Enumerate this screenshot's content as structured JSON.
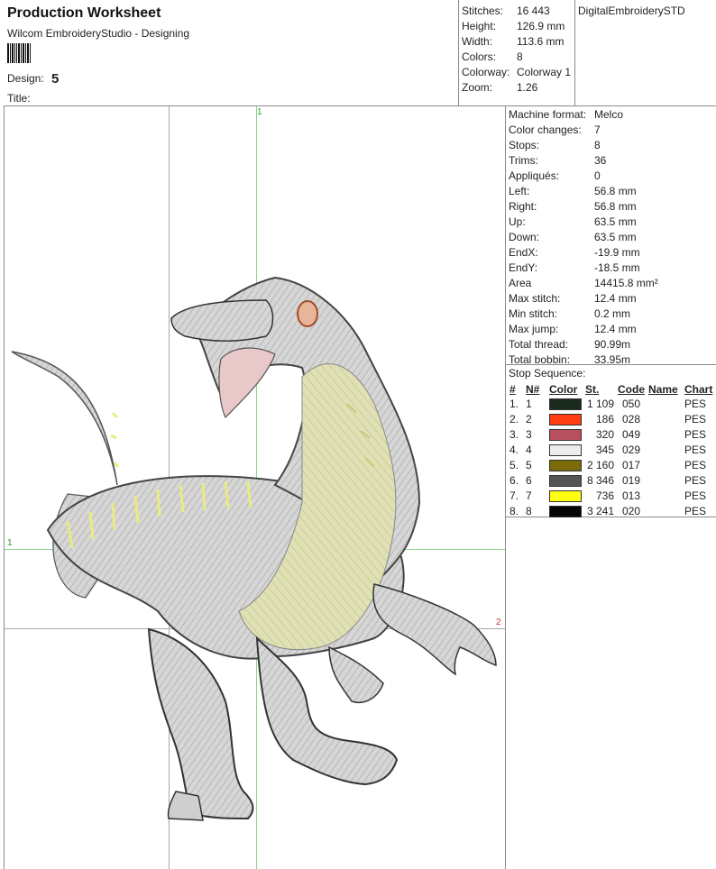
{
  "header": {
    "title": "Production Worksheet",
    "subtitle": "Wilcom EmbroideryStudio - Designing",
    "design_label": "Design:",
    "design_value": "5",
    "title_label": "Title:",
    "brand": "DigitalEmbroiderySTD"
  },
  "summary": [
    {
      "label": "Stitches:",
      "value": "16 443"
    },
    {
      "label": "Height:",
      "value": "126.9 mm"
    },
    {
      "label": "Width:",
      "value": "113.6 mm"
    },
    {
      "label": "Colors:",
      "value": "8"
    },
    {
      "label": "Colorway:",
      "value": "Colorway 1"
    },
    {
      "label": "Zoom:",
      "value": "1.26"
    }
  ],
  "details": [
    {
      "label": "Machine format:",
      "value": "Melco"
    },
    {
      "label": "Color changes:",
      "value": "7"
    },
    {
      "label": "Stops:",
      "value": "8"
    },
    {
      "label": "Trims:",
      "value": "36"
    },
    {
      "label": "Appliqués:",
      "value": "0"
    },
    {
      "label": "Left:",
      "value": "56.8 mm"
    },
    {
      "label": "Right:",
      "value": "56.8 mm"
    },
    {
      "label": "Up:",
      "value": "63.5 mm"
    },
    {
      "label": "Down:",
      "value": "63.5 mm"
    },
    {
      "label": "EndX:",
      "value": "-19.9 mm"
    },
    {
      "label": "EndY:",
      "value": "-18.5 mm"
    },
    {
      "label": "Area",
      "value": "14415.8 mm²"
    },
    {
      "label": "Max stitch:",
      "value": "12.4 mm"
    },
    {
      "label": "Min stitch:",
      "value": "0.2 mm"
    },
    {
      "label": "Max jump:",
      "value": "12.4 mm"
    },
    {
      "label": "Total thread:",
      "value": "90.99m"
    },
    {
      "label": "Total bobbin:",
      "value": "33.95m"
    }
  ],
  "stop_sequence": {
    "title": "Stop Sequence:",
    "headers": [
      "#",
      "N#",
      "Color",
      "St.",
      "Code",
      "Name",
      "Chart"
    ],
    "rows": [
      {
        "num": "1.",
        "n": "1",
        "color": "#1a2a1f",
        "st": "1 109",
        "code": "050",
        "name": "",
        "chart": "PES"
      },
      {
        "num": "2.",
        "n": "2",
        "color": "#ff3d12",
        "st": "186",
        "code": "028",
        "name": "",
        "chart": "PES"
      },
      {
        "num": "3.",
        "n": "3",
        "color": "#b85060",
        "st": "320",
        "code": "049",
        "name": "",
        "chart": "PES"
      },
      {
        "num": "4.",
        "n": "4",
        "color": "#ececec",
        "st": "345",
        "code": "029",
        "name": "",
        "chart": "PES"
      },
      {
        "num": "5.",
        "n": "5",
        "color": "#7a6a08",
        "st": "2 160",
        "code": "017",
        "name": "",
        "chart": "PES"
      },
      {
        "num": "6.",
        "n": "6",
        "color": "#545454",
        "st": "8 346",
        "code": "019",
        "name": "",
        "chart": "PES"
      },
      {
        "num": "7.",
        "n": "7",
        "color": "#ffff10",
        "st": "736",
        "code": "013",
        "name": "",
        "chart": "PES"
      },
      {
        "num": "8.",
        "n": "8",
        "color": "#050505",
        "st": "3 241",
        "code": "020",
        "name": "",
        "chart": "PES"
      }
    ]
  },
  "canvas": {
    "marker_top": "1",
    "marker_left": "1",
    "marker_right": "2",
    "guide_green": "#8fd68f",
    "marker_green": "#2a9a2a",
    "marker_red": "#c03030"
  }
}
